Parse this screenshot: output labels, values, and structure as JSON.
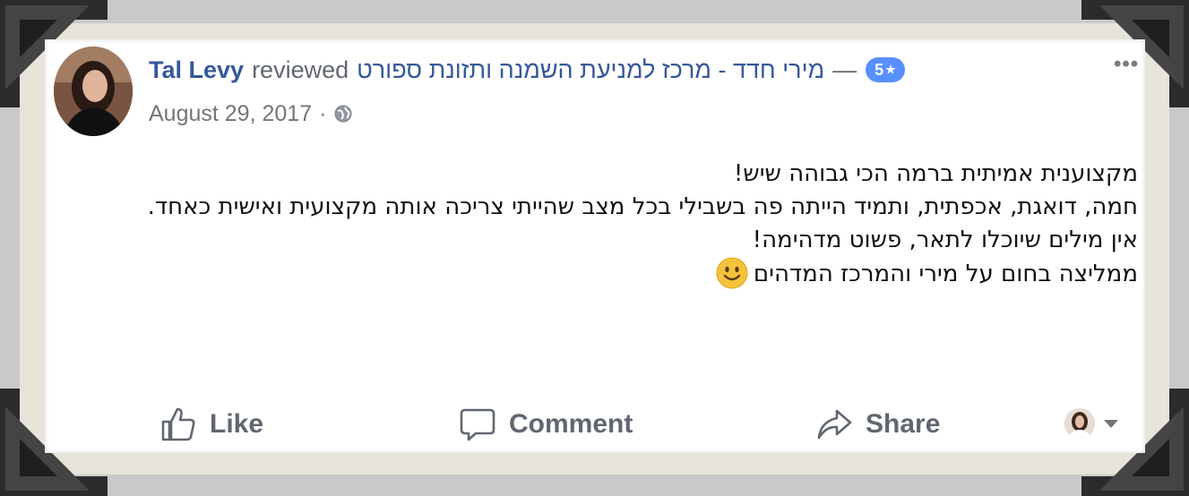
{
  "post": {
    "author": "Tal Levy",
    "action_text": "reviewed",
    "page_name": "מירי חדד - מרכז למניעת השמנה ותזונת ספורט",
    "dash": "—",
    "rating_value": "5",
    "rating_star": "★",
    "more_label": "•••",
    "date": "August 29, 2017",
    "meta_separator": "·",
    "privacy_icon": "globe-icon",
    "body_lines": [
      "מקצוענית אמיתית ברמה הכי גבוהה שיש!",
      "חמה, דואגת, אכפתית, ותמיד הייתה פה בשבילי בכל מצב שהייתי צריכה אותה מקצועית ואישית כאחד.",
      "אין מילים שיוכלו לתאר, פשוט מדהימה!",
      "ממליצה בחום על מירי והמרכז המדהים"
    ],
    "emoji_icon": "smile-emoji-icon"
  },
  "actions": {
    "like_label": "Like",
    "comment_label": "Comment",
    "share_label": "Share"
  },
  "colors": {
    "link_blue": "#365899",
    "rating_blue": "#5890ff",
    "muted_gray": "#616770",
    "frame_mat": "#e6e3da",
    "corner_dark": "#2b2b2b"
  }
}
